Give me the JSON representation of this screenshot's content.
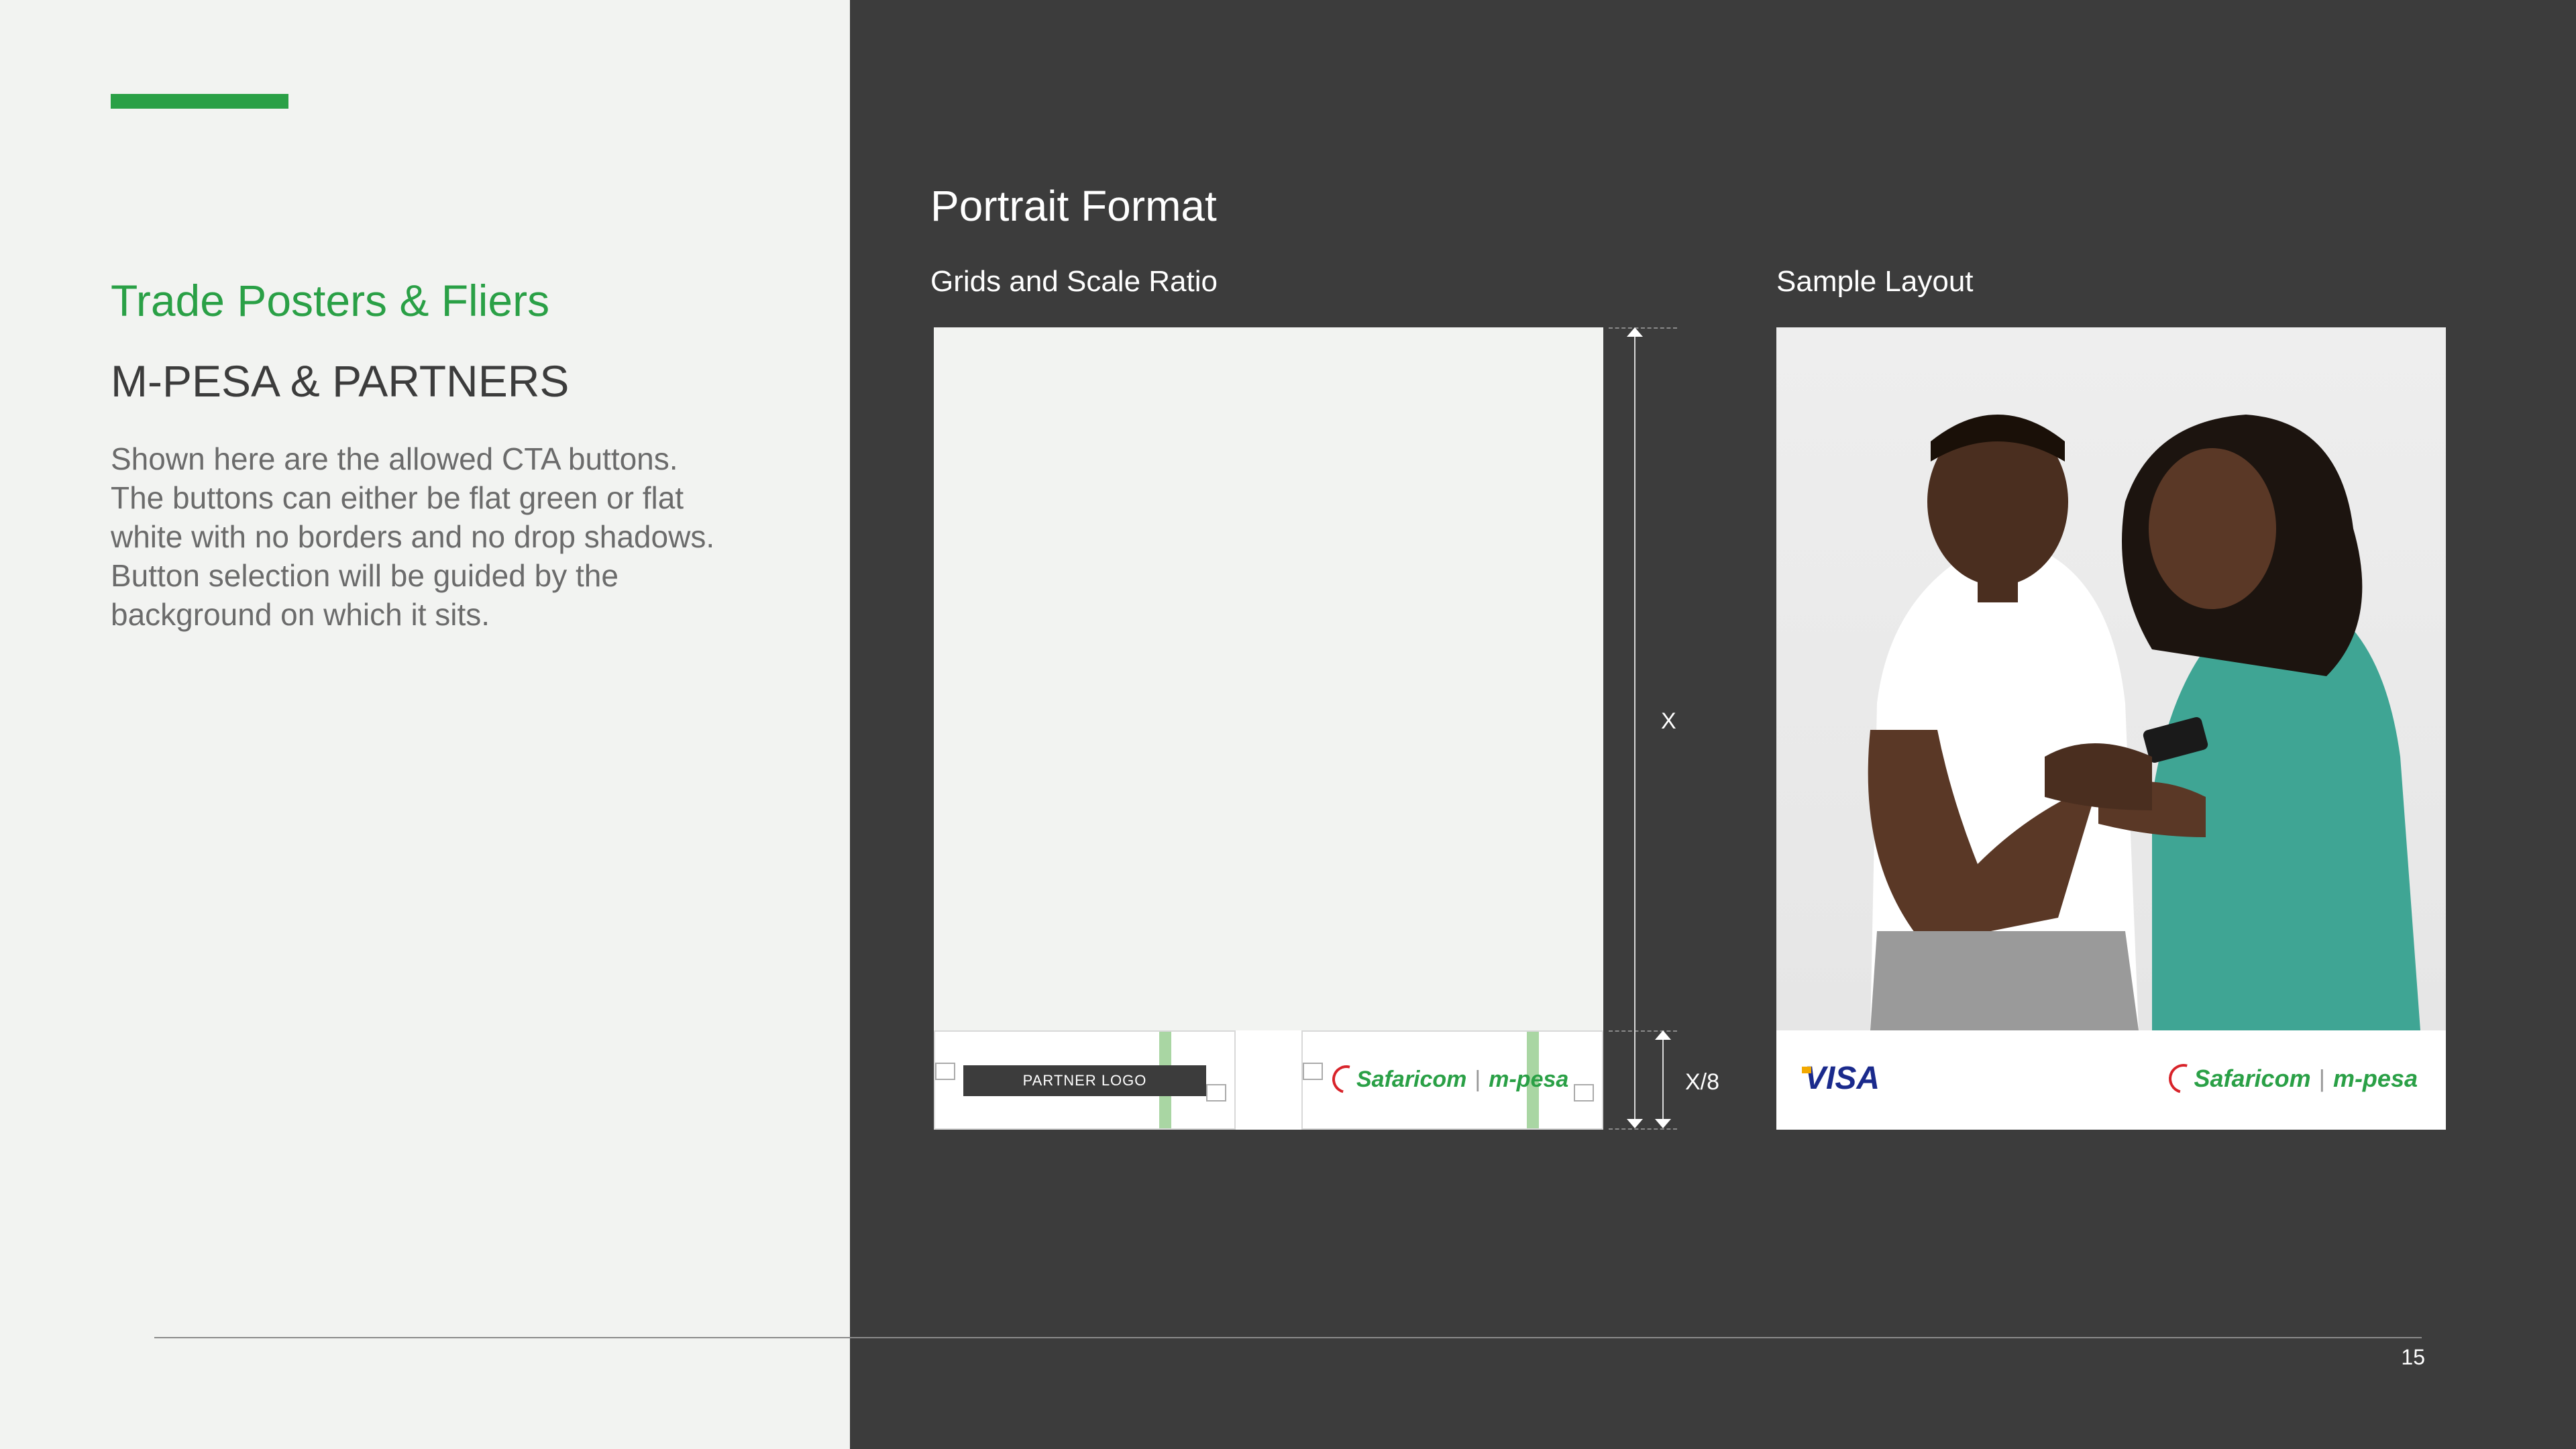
{
  "sidebar": {
    "title": "Trade Posters & Fliers",
    "subtitle": "M-PESA & PARTNERS",
    "description_lines": [
      "Shown here are the allowed CTA buttons.",
      "The buttons can either be flat green or flat",
      "white with no borders and no drop shadows.",
      "Button selection will be guided by the",
      "background on which it sits."
    ]
  },
  "main": {
    "format_title": "Portrait Format",
    "grid_heading": "Grids and Scale Ratio",
    "sample_heading": "Sample Layout",
    "partner_logo_label": "PARTNER LOGO",
    "dimension_main": "X",
    "dimension_footer": "X/8",
    "brand_safaricom": "Safaricom",
    "brand_separator": "|",
    "brand_mpesa": "m-pesa",
    "visa_label": "VISA"
  },
  "footer": {
    "page_number": "15"
  },
  "colors": {
    "accent_green": "#2aa046",
    "dark_panel": "#3c3c3c",
    "light_panel": "#f2f3f1",
    "guide_green": "#a9d6a3",
    "safaricom_red": "#d8232a",
    "visa_blue": "#1a2a8c"
  }
}
